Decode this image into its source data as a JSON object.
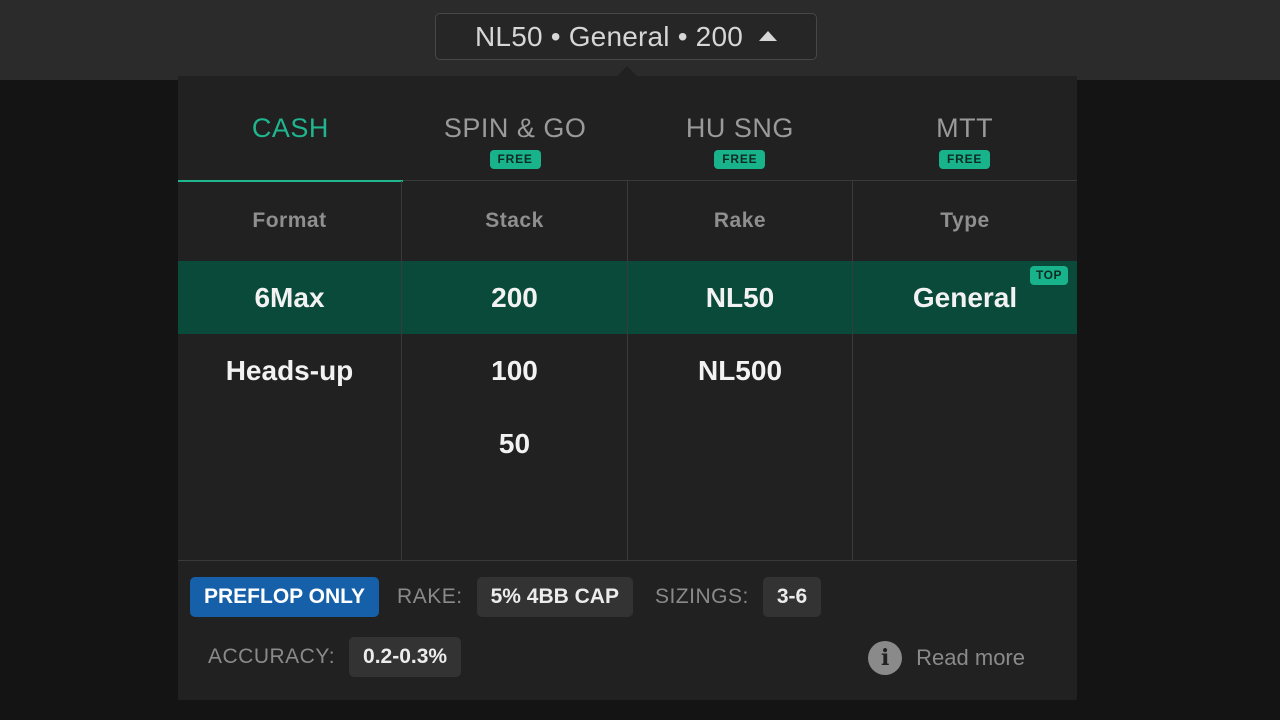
{
  "selector": {
    "label": "NL50 • General • 200"
  },
  "tabs": [
    {
      "label": "CASH",
      "badge": ""
    },
    {
      "label": "SPIN & GO",
      "badge": "FREE"
    },
    {
      "label": "HU SNG",
      "badge": "FREE"
    },
    {
      "label": "MTT",
      "badge": "FREE"
    }
  ],
  "columns": [
    {
      "header": "Format",
      "options": [
        "6Max",
        "Heads-up"
      ]
    },
    {
      "header": "Stack",
      "options": [
        "200",
        "100",
        "50"
      ]
    },
    {
      "header": "Rake",
      "options": [
        "NL50",
        "NL500"
      ]
    },
    {
      "header": "Type",
      "options": [
        "General"
      ],
      "top_badge": "TOP"
    }
  ],
  "footer": {
    "preflop_only": "PREFLOP ONLY",
    "rake_label": "RAKE:",
    "rake_value": "5% 4BB CAP",
    "sizings_label": "SIZINGS:",
    "sizings_value": "3-6",
    "accuracy_label": "ACCURACY:",
    "accuracy_value": "0.2-0.3%",
    "read_more": "Read more"
  },
  "colors": {
    "accent": "#1fb58f",
    "selected_row": "#0a4a3a",
    "preflop_pill": "#1560a8"
  },
  "icons": {
    "caret": "caret-up-icon",
    "info": "info-icon"
  }
}
